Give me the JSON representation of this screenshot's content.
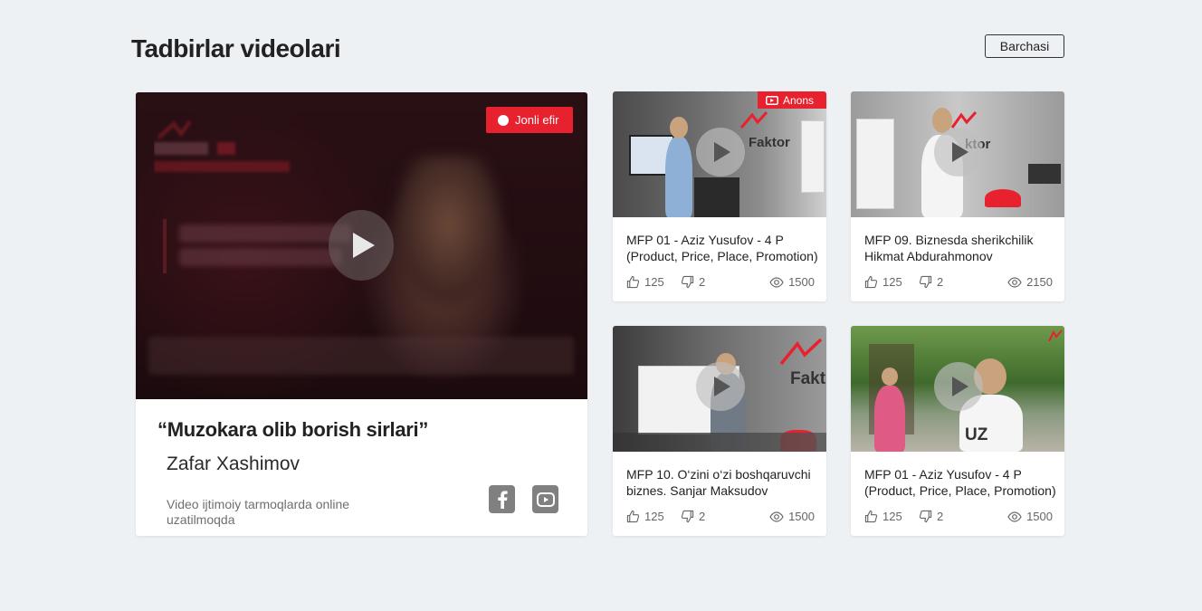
{
  "section": {
    "title": "Tadbirlar videolari",
    "all_button": "Barchasi"
  },
  "featured": {
    "badge": "Jonli efir",
    "title": "“Muzokara olib borish sirlari”",
    "speaker": "Zafar Xashimov",
    "note": "Video ijtimoiy tarmoqlarda online uzatilmoqda",
    "social": [
      "facebook-icon",
      "youtube-icon"
    ]
  },
  "cards": [
    {
      "title": "MFP 01 - Aziz Yusufov - 4 P (Product, Price, Place, Promotion)",
      "likes": "125",
      "dislikes": "2",
      "views": "1500",
      "badge": "Anons",
      "brand": "Faktor"
    },
    {
      "title": "MFP 09. Biznesda sherikchilik Hikmat Abdurahmonov",
      "likes": "125",
      "dislikes": "2",
      "views": "2150",
      "brand": "ktor"
    },
    {
      "title": "MFP 10.  O‘zini o‘zi boshqaruvchi biznes. Sanjar Maksudov",
      "likes": "125",
      "dislikes": "2",
      "views": "1500",
      "brand": "Fakt"
    },
    {
      "title": "MFP 01 - Aziz Yusufov - 4 P (Product, Price, Place, Promotion)",
      "likes": "125",
      "dislikes": "2",
      "views": "1500",
      "brand": "UZ"
    }
  ],
  "colors": {
    "accent": "#e8212f",
    "background": "#eef1f4",
    "icon_gray": "#808080"
  }
}
